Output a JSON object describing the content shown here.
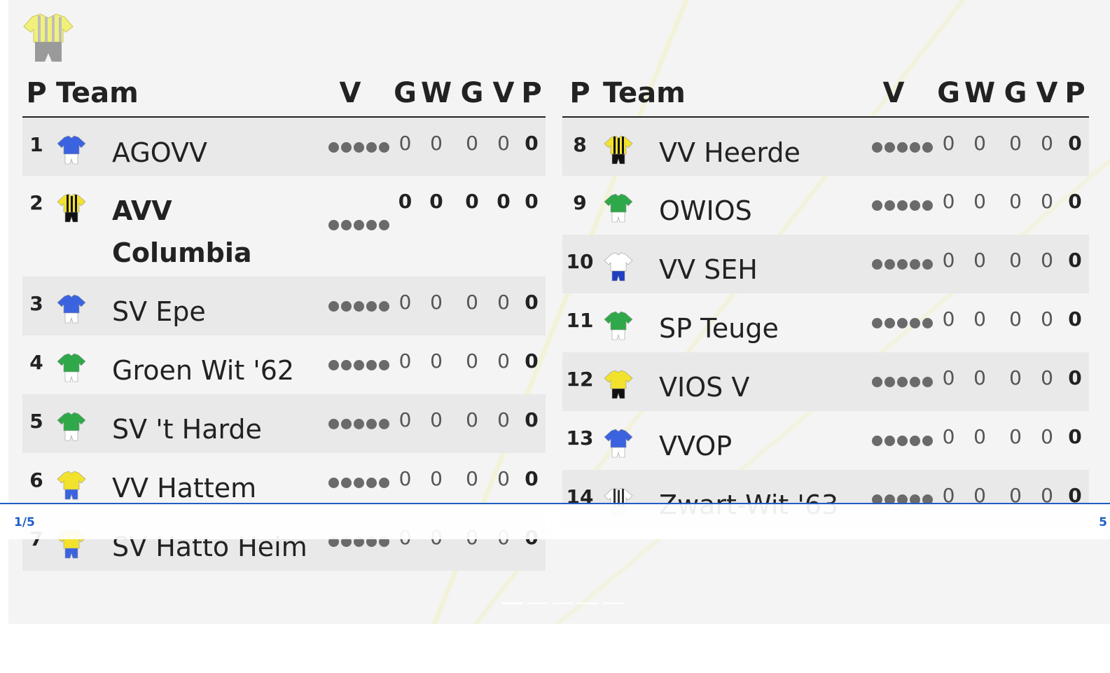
{
  "logo_icon": "striped-kit-icon",
  "headers": {
    "pos": "P",
    "team": "Team",
    "form": "V",
    "played": "G",
    "won": "W",
    "drawn": "G",
    "lost": "V",
    "points": "P"
  },
  "standings_left": [
    {
      "pos": "1",
      "team": "AGOVV",
      "kit": "shirt-blue-icon",
      "played": "0",
      "won": "0",
      "drawn": "0",
      "lost": "0",
      "points": "0"
    },
    {
      "pos": "2",
      "team": "AVV Columbia",
      "kit": "shirt-yellow-black-stripes-icon",
      "played": "0",
      "won": "0",
      "drawn": "0",
      "lost": "0",
      "points": "0"
    },
    {
      "pos": "3",
      "team": "SV Epe",
      "kit": "shirt-blue-icon",
      "played": "0",
      "won": "0",
      "drawn": "0",
      "lost": "0",
      "points": "0"
    },
    {
      "pos": "4",
      "team": "Groen Wit '62",
      "kit": "shirt-green-icon",
      "played": "0",
      "won": "0",
      "drawn": "0",
      "lost": "0",
      "points": "0"
    },
    {
      "pos": "5",
      "team": "SV 't Harde",
      "kit": "shirt-green-icon",
      "played": "0",
      "won": "0",
      "drawn": "0",
      "lost": "0",
      "points": "0"
    },
    {
      "pos": "6",
      "team": "VV Hattem",
      "kit": "shirt-yellow-blue-icon",
      "played": "0",
      "won": "0",
      "drawn": "0",
      "lost": "0",
      "points": "0"
    },
    {
      "pos": "7",
      "team": "SV Hatto Heim",
      "kit": "shirt-yellow-blue-icon",
      "played": "0",
      "won": "0",
      "drawn": "0",
      "lost": "0",
      "points": "0"
    }
  ],
  "standings_right": [
    {
      "pos": "8",
      "team": "VV Heerde",
      "kit": "shirt-yellow-black-stripes-icon",
      "played": "0",
      "won": "0",
      "drawn": "0",
      "lost": "0",
      "points": "0"
    },
    {
      "pos": "9",
      "team": "OWIOS",
      "kit": "shirt-green-icon",
      "played": "0",
      "won": "0",
      "drawn": "0",
      "lost": "0",
      "points": "0"
    },
    {
      "pos": "10",
      "team": "VV SEH",
      "kit": "shirt-white-blue-icon",
      "played": "0",
      "won": "0",
      "drawn": "0",
      "lost": "0",
      "points": "0"
    },
    {
      "pos": "11",
      "team": "SP Teuge",
      "kit": "shirt-green-icon",
      "played": "0",
      "won": "0",
      "drawn": "0",
      "lost": "0",
      "points": "0"
    },
    {
      "pos": "12",
      "team": "VIOS V",
      "kit": "shirt-yellow-black-icon",
      "played": "0",
      "won": "0",
      "drawn": "0",
      "lost": "0",
      "points": "0"
    },
    {
      "pos": "13",
      "team": "VVOP",
      "kit": "shirt-blue-icon",
      "played": "0",
      "won": "0",
      "drawn": "0",
      "lost": "0",
      "points": "0"
    },
    {
      "pos": "14",
      "team": "Zwart-Wit '63",
      "kit": "shirt-black-white-stripes-icon",
      "played": "0",
      "won": "0",
      "drawn": "0",
      "lost": "0",
      "points": "0"
    }
  ],
  "pager": {
    "left": "1/5",
    "right": "5"
  },
  "colors": {
    "accent": "#1f5fc6",
    "panel": "#f4f4f4",
    "row_shade": "#e9e9e9",
    "form_dot": "#6a6a6a"
  }
}
